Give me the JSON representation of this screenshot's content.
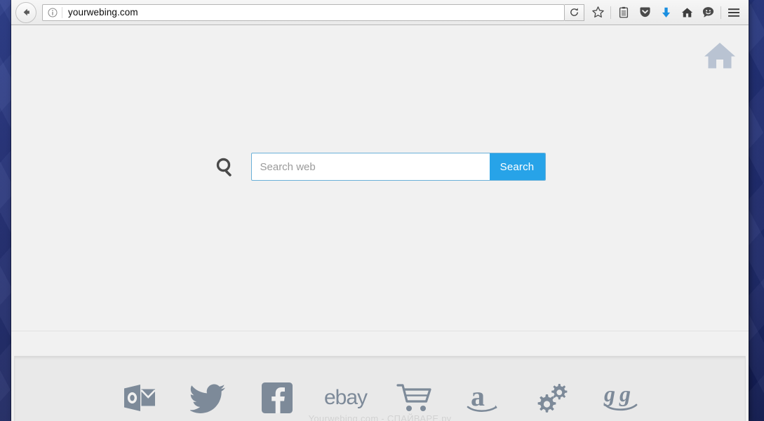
{
  "browser": {
    "url": "yourwebing.com",
    "back_label": "Back",
    "identity_icon": "info-circle-icon",
    "reload_label": "Reload",
    "toolbar_icons": [
      {
        "name": "bookmark-star-icon",
        "label": "Bookmark this page"
      },
      {
        "name": "reader-list-icon",
        "label": "Reading list"
      },
      {
        "name": "pocket-shield-icon",
        "label": "Save to Pocket"
      },
      {
        "name": "download-arrow-icon",
        "label": "Downloads"
      },
      {
        "name": "home-icon",
        "label": "Home"
      },
      {
        "name": "feedback-smiley-icon",
        "label": "Feedback"
      },
      {
        "name": "hamburger-menu-icon",
        "label": "Open menu"
      }
    ]
  },
  "page": {
    "home_corner_icon": "home-icon",
    "search": {
      "glass_icon": "search-magnifier-icon",
      "placeholder": "Search web",
      "value": "",
      "button_label": "Search"
    },
    "shortcuts": [
      {
        "name": "shortcut-outlook",
        "icon": "outlook-icon",
        "label": "Outlook"
      },
      {
        "name": "shortcut-twitter",
        "icon": "twitter-bird-icon",
        "label": "Twitter"
      },
      {
        "name": "shortcut-facebook",
        "icon": "facebook-icon",
        "label": "Facebook"
      },
      {
        "name": "shortcut-ebay",
        "icon": "ebay-icon",
        "label": "ebay"
      },
      {
        "name": "shortcut-cart",
        "icon": "shopping-cart-icon",
        "label": "Shopping"
      },
      {
        "name": "shortcut-amazon",
        "icon": "amazon-icon",
        "label": "Amazon"
      },
      {
        "name": "shortcut-settings",
        "icon": "gears-icon",
        "label": "Settings"
      },
      {
        "name": "shortcut-gg",
        "icon": "gg-smile-icon",
        "label": "gg"
      }
    ],
    "footer_note": "Yourwebing.com - СПАЙВАРЕ.ру"
  },
  "colors": {
    "accent_blue": "#27a3e8",
    "search_border": "#6ab0d8",
    "icon_gray": "#7d8a99",
    "page_bg": "#f1f1f1",
    "panel_bg": "#e9e9e9",
    "desktop_blue": "#16267a"
  }
}
